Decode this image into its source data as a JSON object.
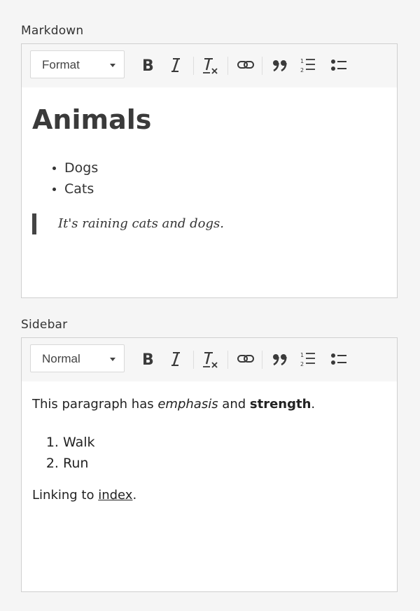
{
  "markdown_field": {
    "label": "Markdown",
    "toolbar": {
      "format_select": "Format"
    },
    "content": {
      "heading": "Animals",
      "list": [
        "Dogs",
        "Cats"
      ],
      "blockquote": "It's raining cats and dogs."
    }
  },
  "sidebar_field": {
    "label": "Sidebar",
    "toolbar": {
      "format_select": "Normal"
    },
    "content": {
      "para1": {
        "text1": "This paragraph has ",
        "emphasis": "emphasis",
        "text2": " and ",
        "strength": "strength",
        "text3": "."
      },
      "ordered_list": [
        "Walk",
        "Run"
      ],
      "para2": {
        "text1": "Linking to ",
        "link": "index",
        "text2": "."
      }
    }
  },
  "toolbar_icons": [
    "bold-icon",
    "italic-icon",
    "clear-format-icon",
    "link-icon",
    "blockquote-icon",
    "numbered-list-icon",
    "bulleted-list-icon"
  ]
}
